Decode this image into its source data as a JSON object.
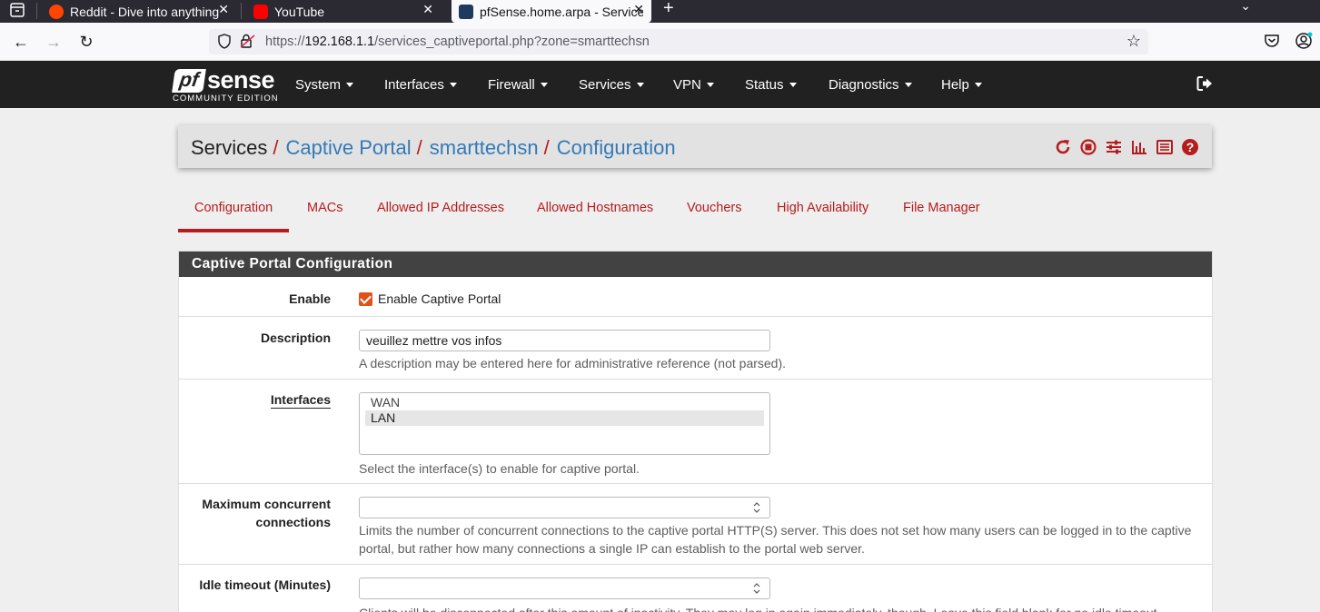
{
  "browser": {
    "tabs": [
      {
        "title": "Reddit - Dive into anything",
        "favicon_color": "#ff4500"
      },
      {
        "title": "YouTube",
        "favicon_color": "#ff0000"
      },
      {
        "title": "pfSense.home.arpa - Services: Captive Portal",
        "favicon_color": "#1e3a5f"
      }
    ],
    "close_glyph": "✕",
    "new_tab_glyph": "+",
    "tab_menu_glyph": "⌄",
    "url_prefix": "https://",
    "url_host": "192.168.1.1",
    "url_path": "/services_captiveportal.php?zone=smarttechsn",
    "back_glyph": "←",
    "forward_glyph": "→",
    "reload_glyph": "↻",
    "star_glyph": "☆"
  },
  "pfsense": {
    "logo_pf": "pf",
    "logo_sense": "sense",
    "logo_edition": "COMMUNITY EDITION",
    "menu": [
      "System",
      "Interfaces",
      "Firewall",
      "Services",
      "VPN",
      "Status",
      "Diagnostics",
      "Help"
    ]
  },
  "breadcrumb": {
    "root": "Services",
    "items": [
      "Captive Portal",
      "smarttechsn",
      "Configuration"
    ],
    "separator": "/"
  },
  "tabs": [
    "Configuration",
    "MACs",
    "Allowed IP Addresses",
    "Allowed Hostnames",
    "Vouchers",
    "High Availability",
    "File Manager"
  ],
  "panel": {
    "title": "Captive Portal Configuration",
    "enable": {
      "label": "Enable",
      "checkbox_label": "Enable Captive Portal",
      "checked": true
    },
    "description": {
      "label": "Description",
      "value": "veuillez mettre vos infos",
      "help": "A description may be entered here for administrative reference (not parsed)."
    },
    "interfaces": {
      "label": "Interfaces",
      "options": [
        "WAN",
        "LAN"
      ],
      "selected": "LAN",
      "help": "Select the interface(s) to enable for captive portal."
    },
    "max_connections": {
      "label_line1": "Maximum concurrent",
      "label_line2": "connections",
      "value": "",
      "help_line1": "Limits the number of concurrent connections to the captive portal HTTP(S) server. This does not set how many users can be logged in to the captive",
      "help_line2": "portal, but rather how many connections a single IP can establish to the portal web server."
    },
    "idle_timeout": {
      "label": "Idle timeout (Minutes)",
      "value": "",
      "help": "Clients will be disconnected after this amount of inactivity. They may log in again immediately, though. Leave this field blank for no idle timeout."
    }
  },
  "colors": {
    "accent_red": "#b71c1c",
    "link_blue": "#337ab7",
    "nav_dark": "#212121",
    "panel_head": "#424242",
    "checkbox_orange": "#e0521c"
  }
}
